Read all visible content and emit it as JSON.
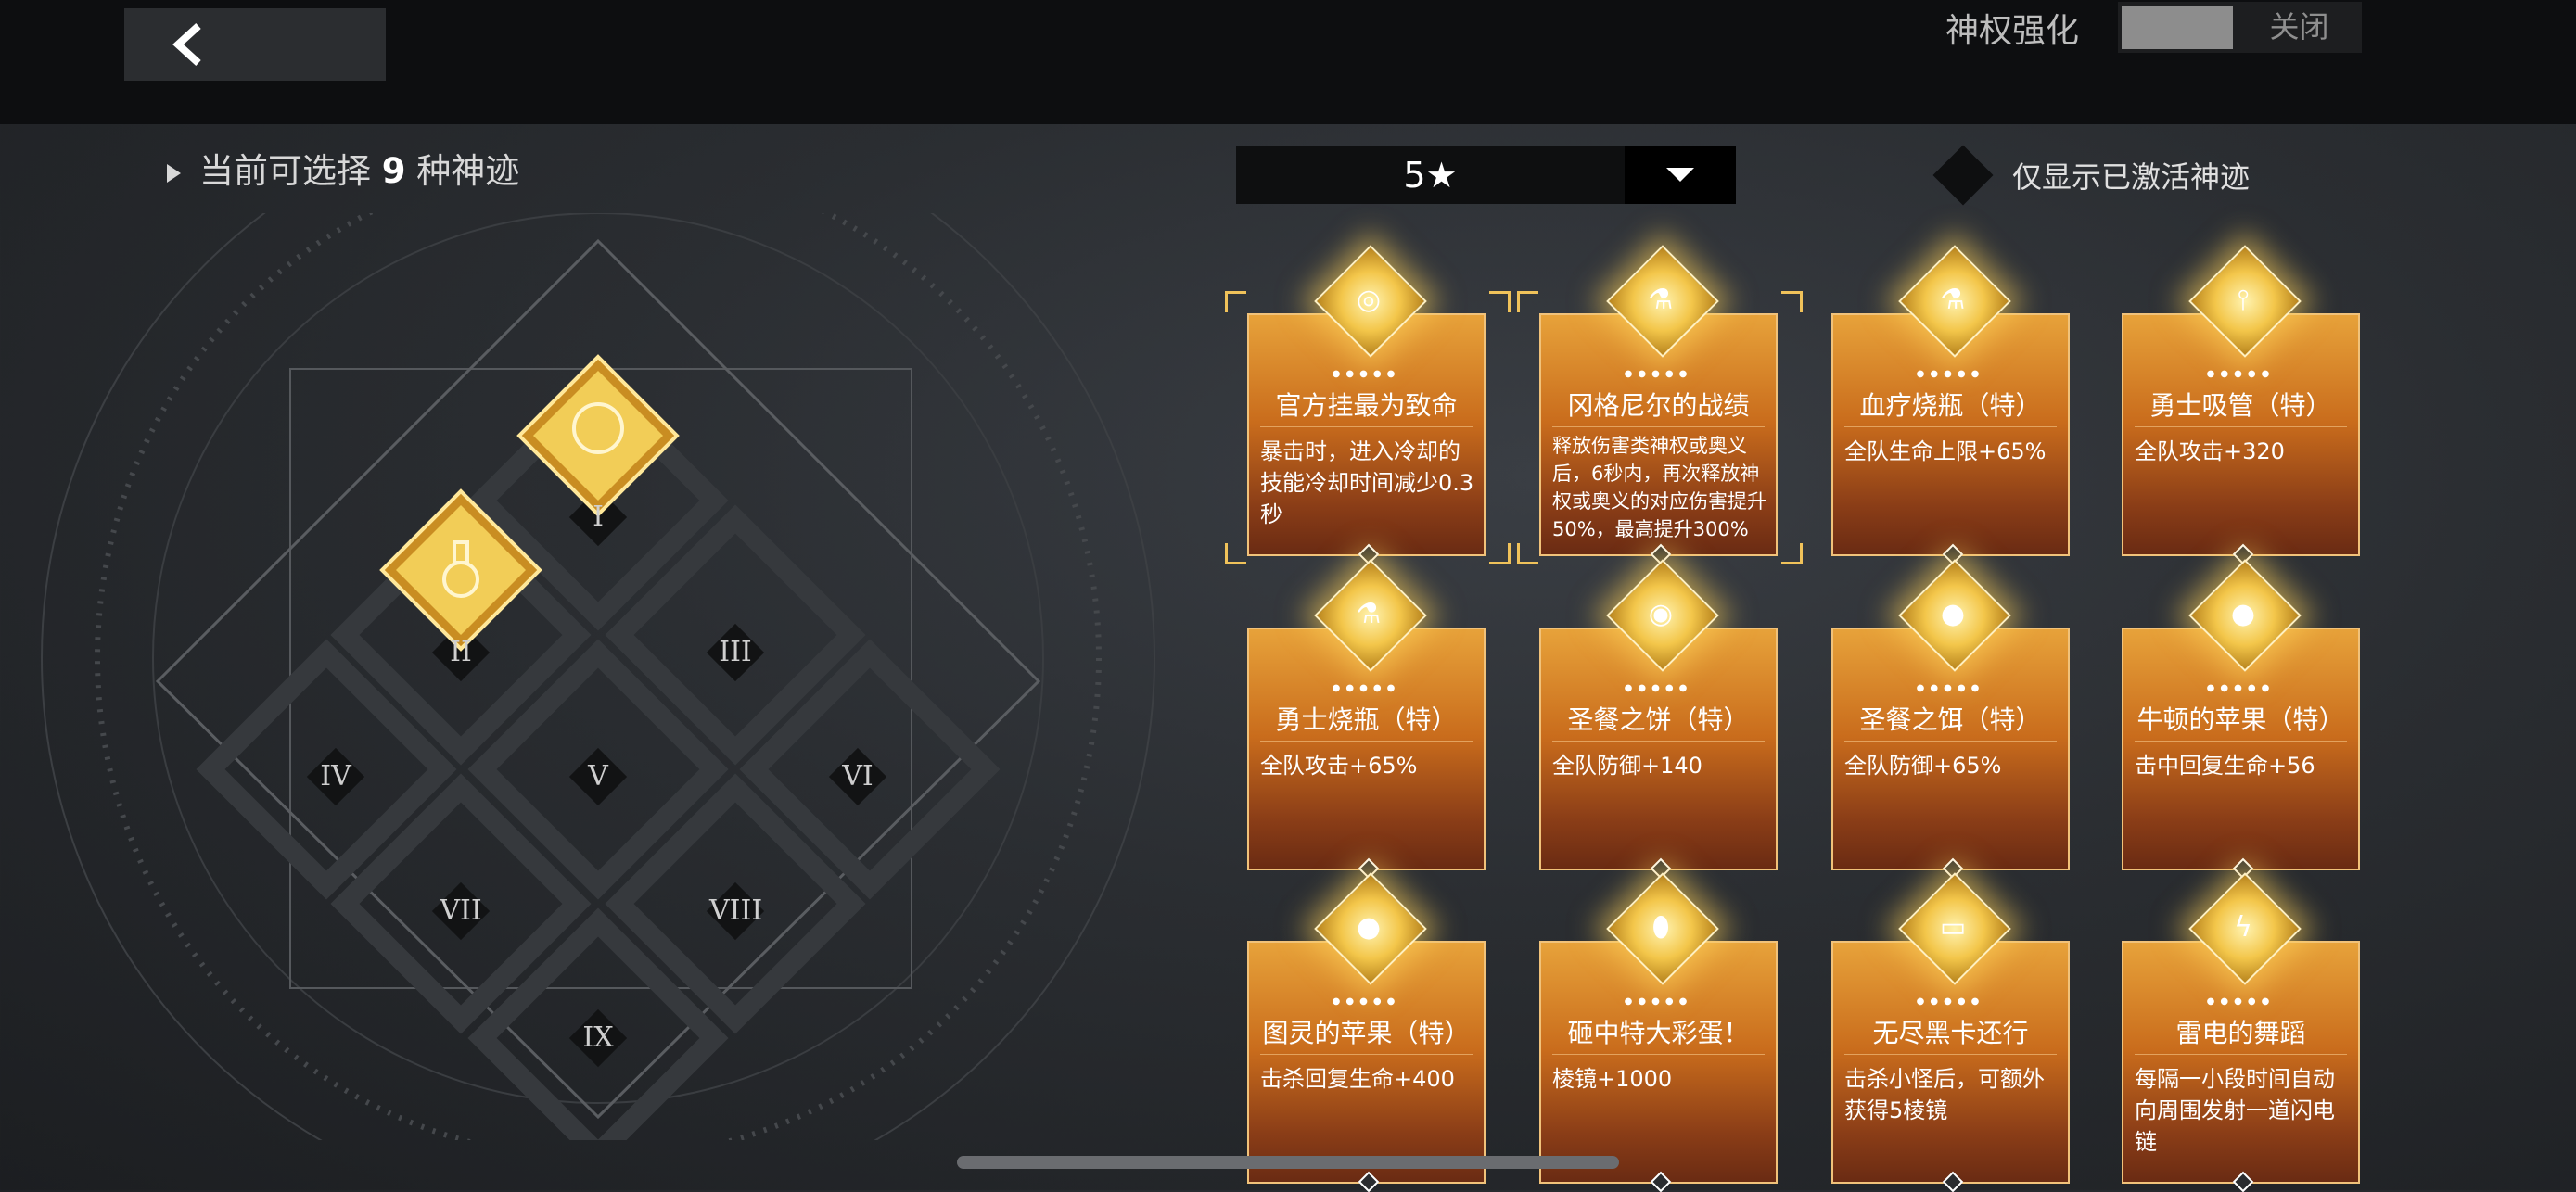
{
  "topbar": {
    "toggle_label": "神权强化",
    "toggle_state": "关闭"
  },
  "available": {
    "prefix": "当前可选择",
    "count": "9",
    "suffix": "种神迹"
  },
  "star_filter": {
    "value": "5★"
  },
  "activated_filter": {
    "label": "仅显示已激活神迹"
  },
  "board": {
    "slots": [
      "I",
      "II",
      "III",
      "IV",
      "V",
      "VI",
      "VII",
      "VIII",
      "IX"
    ]
  },
  "cards": [
    {
      "title": "官方挂最为致命",
      "desc": "暴击时，进入冷却的技能冷却时间减少0.3秒",
      "icon": "compass-icon",
      "selected": true
    },
    {
      "title": "冈格尼尔的战绩",
      "desc": "释放伤害类神权或奥义后，6秒内，再次释放神权或奥义的对应伤害提升50%，最高提升300%",
      "icon": "flask-icon",
      "selected": true
    },
    {
      "title": "血疗烧瓶（特）",
      "desc": "全队生命上限+65%",
      "icon": "flask-icon",
      "selected": false
    },
    {
      "title": "勇士吸管（特）",
      "desc": "全队攻击+320",
      "icon": "straw-icon",
      "selected": false
    },
    {
      "title": "勇士烧瓶（特）",
      "desc": "全队攻击+65%",
      "icon": "beaker-icon",
      "selected": false
    },
    {
      "title": "圣餐之饼（特）",
      "desc": "全队防御+140",
      "icon": "pie-icon",
      "selected": false
    },
    {
      "title": "圣餐之饵（特）",
      "desc": "全队防御+65%",
      "icon": "cookie-icon",
      "selected": false
    },
    {
      "title": "牛顿的苹果（特）",
      "desc": "击中回复生命+56",
      "icon": "apple-icon",
      "selected": false
    },
    {
      "title": "图灵的苹果（特）",
      "desc": "击杀回复生命+400",
      "icon": "apple-icon",
      "selected": false
    },
    {
      "title": "砸中特大彩蛋！",
      "desc": "棱镜+1000",
      "icon": "egg-icon",
      "selected": false
    },
    {
      "title": "无尽黑卡还行",
      "desc": "击杀小怪后，可额外获得5棱镜",
      "icon": "card-icon",
      "selected": false
    },
    {
      "title": "雷电的舞蹈",
      "desc": "每隔一小段时间自动向周围发射一道闪电链",
      "icon": "lightning-icon",
      "selected": false
    }
  ]
}
